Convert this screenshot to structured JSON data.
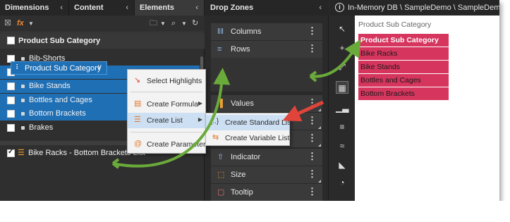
{
  "left_panel": {
    "tabs": [
      {
        "label": "Dimensions"
      },
      {
        "label": "Content"
      },
      {
        "label": "Elements"
      }
    ],
    "fields_header": "Product Sub Category",
    "fields": [
      {
        "label": "Bib-Shorts",
        "selected": false
      },
      {
        "label": "Bike Racks",
        "selected": true
      },
      {
        "label": "Bike Stands",
        "selected": true
      },
      {
        "label": "Bottles and Cages",
        "selected": true
      },
      {
        "label": "Bottom Brackets",
        "selected": true
      },
      {
        "label": "Brakes",
        "selected": false
      }
    ],
    "custom_list": {
      "label": "Bike Racks - Bottom Brackets List",
      "checked": true
    }
  },
  "context_menu": {
    "items": [
      {
        "label": "Select Highlights",
        "icon": "select-highlights-icon"
      },
      {
        "label": "Create Formula",
        "icon": "formula-icon"
      },
      {
        "label": "Create List",
        "icon": "list-icon"
      },
      {
        "label": "Create Parameter",
        "icon": "parameter-icon"
      }
    ],
    "submenu": [
      {
        "label": "Create Standard List",
        "icon": "standard-list-icon"
      },
      {
        "label": "Create Variable List",
        "icon": "variable-list-icon"
      }
    ]
  },
  "drop_zones": {
    "title": "Drop Zones",
    "zones": [
      {
        "label": "Columns",
        "icon": "columns-icon"
      },
      {
        "label": "Rows",
        "icon": "rows-icon"
      },
      {
        "label": "Values",
        "icon": "values-icon"
      },
      {
        "label": "Indicator",
        "icon": "indicator-icon"
      },
      {
        "label": "Size",
        "icon": "size-icon"
      },
      {
        "label": "Tooltip",
        "icon": "tooltip-icon"
      }
    ],
    "rows_chip": "Product Sub Category"
  },
  "canvas": {
    "path": "In-Memory DB \\ SampleDemo \\ SampleDemo",
    "column_header": "Product Sub Category",
    "table": {
      "header": "Product Sub Category",
      "rows": [
        "Bike Racks",
        "Bike Stands",
        "Bottles and Cages",
        "Bottom Brackets"
      ]
    }
  },
  "colors": {
    "selection_blue": "#1f6fb5",
    "table_pink": "#d6355e",
    "arrow_green": "#6aaa3a",
    "arrow_red": "#e0443a"
  }
}
